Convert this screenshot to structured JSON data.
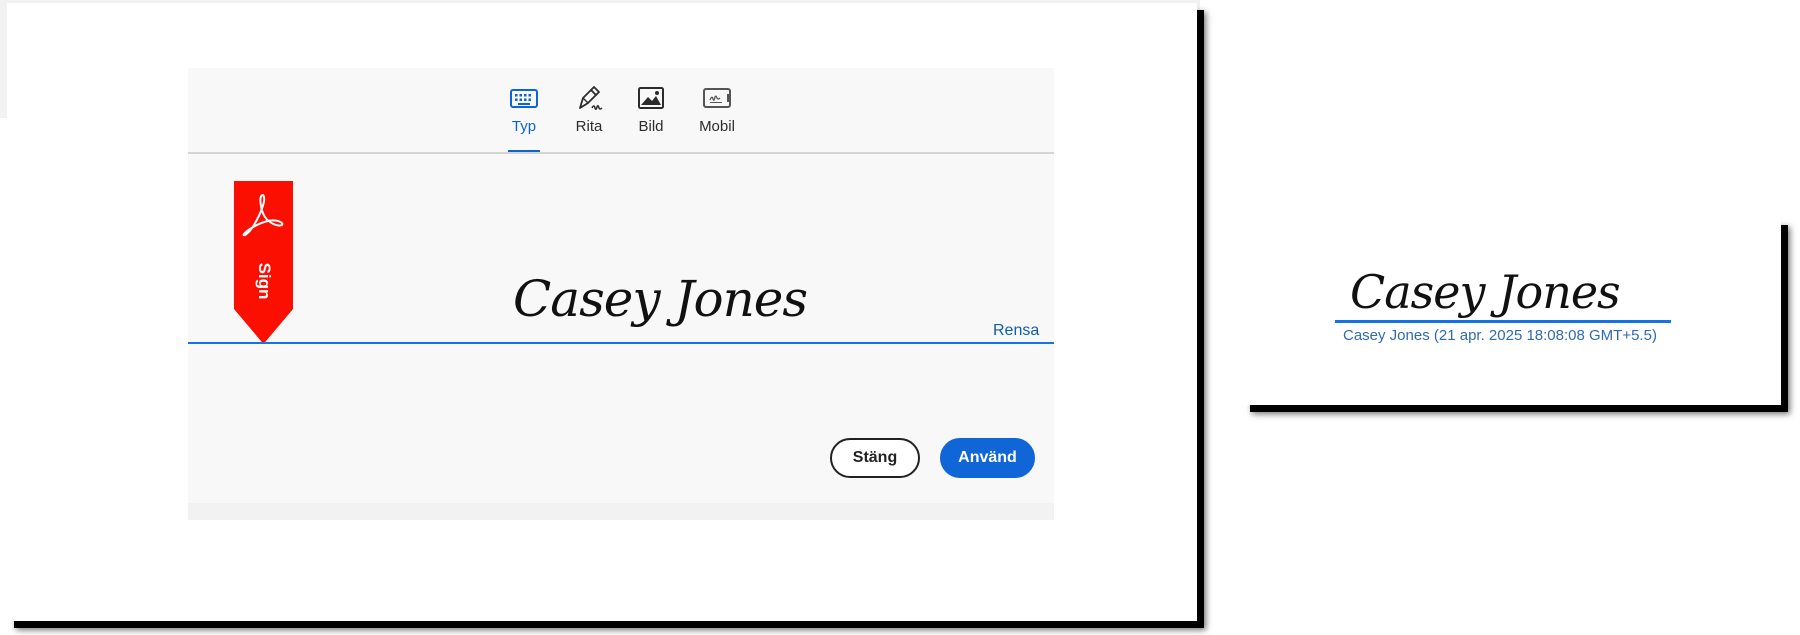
{
  "signature_dialog": {
    "tabs": [
      {
        "label": "Typ",
        "icon": "keyboard-icon",
        "active": true
      },
      {
        "label": "Rita",
        "icon": "pen-draw-icon",
        "active": false
      },
      {
        "label": "Bild",
        "icon": "image-icon",
        "active": false
      },
      {
        "label": "Mobil",
        "icon": "mobile-signature-icon",
        "active": false
      }
    ],
    "badge": {
      "label": "Sign",
      "icon": "acrobat-icon",
      "color": "#fa0f00"
    },
    "signature_value": "Casey Jones",
    "clear_label": "Rensa",
    "buttons": {
      "close_label": "Stäng",
      "apply_label": "Använd"
    },
    "accent_color": "#1473e6"
  },
  "applied_signature": {
    "signature_text": "Casey Jones",
    "caption": "Casey Jones (21 apr. 2025 18:08:08 GMT+5.5)"
  }
}
